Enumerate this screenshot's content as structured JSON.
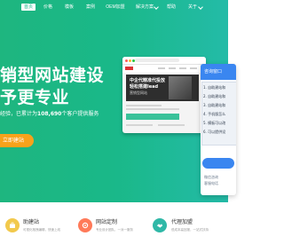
{
  "nav": {
    "items": [
      {
        "label": "首页",
        "active": true
      },
      {
        "label": "价格",
        "active": false
      },
      {
        "label": "模板",
        "active": false
      },
      {
        "label": "案例",
        "active": false
      },
      {
        "label": "OEM加盟",
        "active": false
      },
      {
        "label": "解决方案",
        "active": false
      },
      {
        "label": "帮助",
        "active": false
      },
      {
        "label": "关于",
        "active": false
      }
    ],
    "dropdown_icon": "chevron-down-icon"
  },
  "hero": {
    "title_line1": "销型网站建设",
    "title_line2": "予更专业",
    "subtitle_prefix": "经验，已累计为",
    "subtitle_count": "108,690",
    "subtitle_suffix": "个客户提供服务",
    "cta_label": "立即建站"
  },
  "mockup": {
    "headline_line1": "中企代精准代投放",
    "headline_line2": "轻松搭建lead",
    "caption": "营销型网站"
  },
  "chat": {
    "title": "咨询窗口",
    "items": [
      "1. 自助建站和",
      "2. 自助建站和",
      "3. 自助建站和",
      "4. 手机版怎么",
      "5. 模板可以改",
      "6. 可以提供设"
    ],
    "footer_line1": "微信咨询",
    "footer_line2": "客服电话"
  },
  "features": [
    {
      "icon": "briefcase-icon",
      "title": "助建站",
      "desc": "可视化拖拽编辑，快速上线",
      "color": "#f2c94c"
    },
    {
      "icon": "gear-icon",
      "title": "网站定制",
      "desc": "专业设计团队，一对一服务",
      "color": "#ff7a59"
    },
    {
      "icon": "handshake-icon",
      "title": "代理加盟",
      "desc": "低成本高回报，一站式扶持",
      "color": "#2fb8a7"
    }
  ],
  "colors": {
    "brand": "#19b88a",
    "cta": "#f7a21b",
    "chat_accent": "#3a86f0"
  }
}
